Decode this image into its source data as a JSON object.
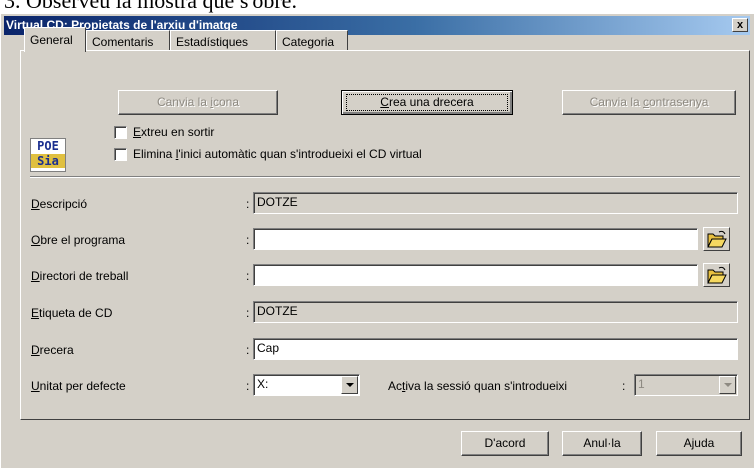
{
  "background_text": "3. Observeu la mostra que s'obre.",
  "window": {
    "title": "Virtual CD: Propietats de l'arxiu d'imatge",
    "close_glyph": "x"
  },
  "tabs": [
    {
      "label": "General",
      "active": true
    },
    {
      "label": "Comentaris"
    },
    {
      "label": "Estadístiques"
    },
    {
      "label": "Categoria"
    }
  ],
  "top_buttons": {
    "change_icon": {
      "before": "Canvia la ",
      "key": "i",
      "after": "cona",
      "disabled": true
    },
    "create_shortcut": {
      "before": "",
      "key": "C",
      "after": "rea una drecera"
    },
    "change_password": {
      "before": "Canvia la ",
      "key": "c",
      "after": "ontrasenya",
      "disabled": true
    }
  },
  "logo": {
    "line1": "POE",
    "line2": "Sia"
  },
  "checkboxes": [
    {
      "before": "",
      "key": "E",
      "after": "xtreu en sortir",
      "checked": false
    },
    {
      "before": "Elimina ",
      "key": "l",
      "after": "'inici automàtic quan s'introdueixi el CD virtual",
      "checked": false
    }
  ],
  "fields": [
    {
      "label_key": "D",
      "label_rest": "escripció",
      "colon": ":",
      "value": "DOTZE",
      "editable": false
    },
    {
      "label_key": "O",
      "label_rest": "bre el programa",
      "colon": ":",
      "value": "",
      "editable": true
    },
    {
      "label_key": "D",
      "label_rest": "irectori de treball",
      "colon": ":",
      "value": "",
      "editable": true
    },
    {
      "label_key": "E",
      "label_rest": "tiqueta de CD",
      "colon": ":",
      "value": "DOTZE",
      "editable": false
    },
    {
      "label_key": "D",
      "label_rest": "recera",
      "colon": ":",
      "value": "Cap",
      "editable": true
    },
    {
      "label_key": "U",
      "label_rest": "nitat per defecte",
      "colon": ":",
      "value": "X:",
      "editable": true
    }
  ],
  "session": {
    "label_before": "Ac",
    "label_key": "t",
    "label_after": "iva la sessió quan s'introdueixi",
    "colon": ":",
    "value": "1",
    "disabled": true
  },
  "bottom_buttons": {
    "ok": "D'acord",
    "cancel": "Anul·la",
    "help": "Ajuda"
  },
  "icons": {
    "open_folder": "open-folder-icon",
    "dropdown": "chevron-down-icon",
    "close": "close-icon"
  }
}
